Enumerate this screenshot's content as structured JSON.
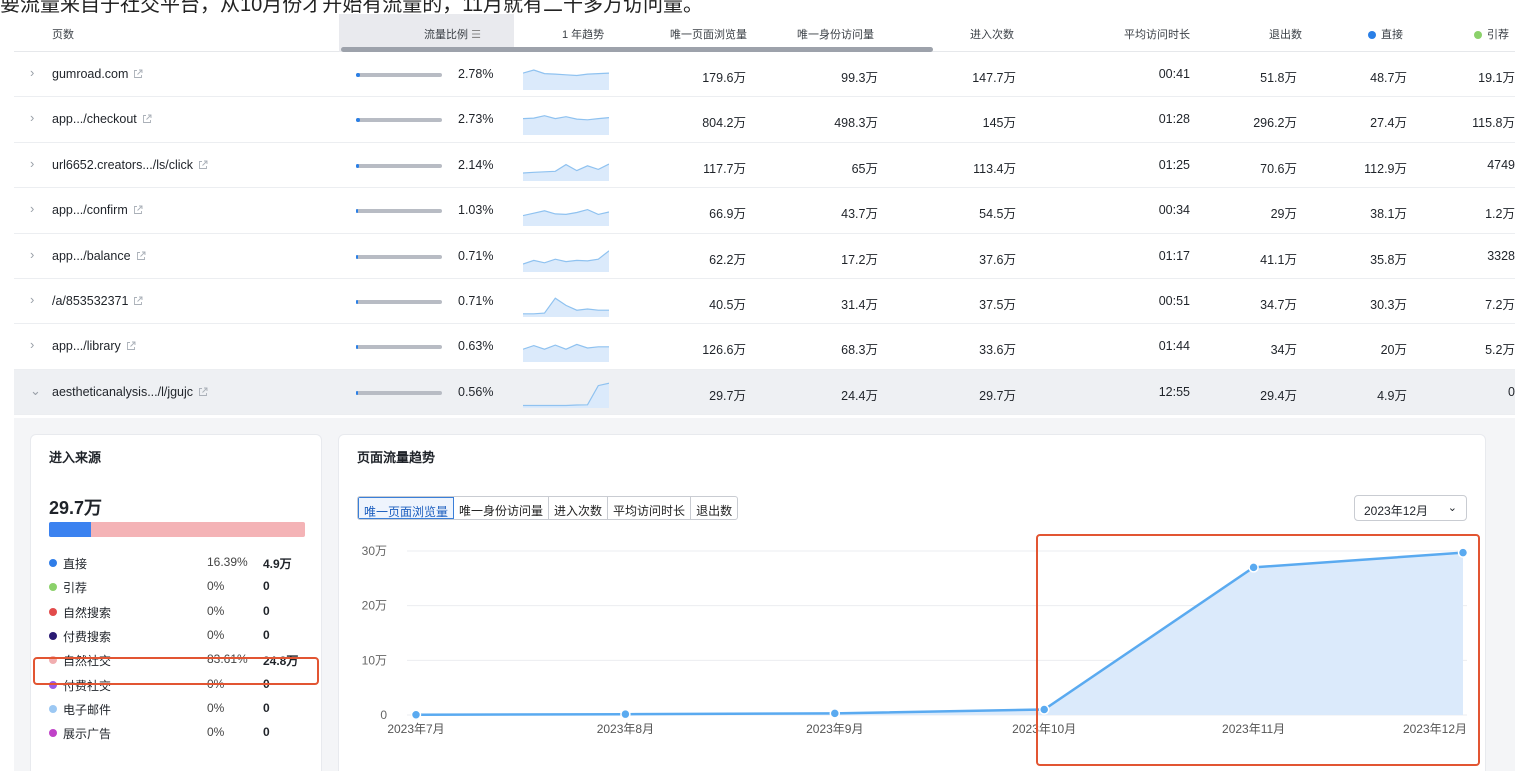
{
  "caption": "要流量来自于社交平台，从10月份才开始有流量的，11月就有二十多万访问量。",
  "table": {
    "columns": {
      "page": "页数",
      "traffic_share": "流量比例",
      "trend": "1 年趋势",
      "unique_pageviews": "唯一页面浏览量",
      "unique_visitors": "唯一身份访问量",
      "entrances": "进入次数",
      "avg_duration": "平均访问时长",
      "exits": "退出数",
      "direct": "直接",
      "referral": "引荐"
    },
    "legend_colors": {
      "direct": "#2a7fe6",
      "referral": "#8bd16a"
    },
    "rows": [
      {
        "page": "gumroad.com",
        "share_text": "2.78%",
        "share": 0.0278,
        "unique_pageviews": "179.6万",
        "unique_visitors": "99.3万",
        "entrances": "147.7万",
        "avg_duration": "00:41",
        "exits": "51.8万",
        "direct": "48.7万",
        "referral": "19.1万",
        "trend": [
          0.62,
          0.75,
          0.6,
          0.58,
          0.55,
          0.52,
          0.58,
          0.6,
          0.62
        ]
      },
      {
        "page": "app.../checkout",
        "share_text": "2.73%",
        "share": 0.0273,
        "unique_pageviews": "804.2万",
        "unique_visitors": "498.3万",
        "entrances": "145万",
        "avg_duration": "01:28",
        "exits": "296.2万",
        "direct": "27.4万",
        "referral": "115.8万",
        "trend": [
          0.6,
          0.62,
          0.72,
          0.6,
          0.68,
          0.58,
          0.55,
          0.6,
          0.64
        ]
      },
      {
        "page": "url6652.creators.../ls/click",
        "share_text": "2.14%",
        "share": 0.0214,
        "unique_pageviews": "117.7万",
        "unique_visitors": "65万",
        "entrances": "113.4万",
        "avg_duration": "01:25",
        "exits": "70.6万",
        "direct": "112.9万",
        "referral": "4749",
        "trend": [
          0.25,
          0.28,
          0.3,
          0.32,
          0.6,
          0.35,
          0.55,
          0.4,
          0.62
        ]
      },
      {
        "page": "app.../confirm",
        "share_text": "1.03%",
        "share": 0.0103,
        "unique_pageviews": "66.9万",
        "unique_visitors": "43.7万",
        "entrances": "54.5万",
        "avg_duration": "00:34",
        "exits": "29万",
        "direct": "38.1万",
        "referral": "1.2万",
        "trend": [
          0.35,
          0.45,
          0.55,
          0.42,
          0.4,
          0.48,
          0.6,
          0.4,
          0.5
        ]
      },
      {
        "page": "app.../balance",
        "share_text": "0.71%",
        "share": 0.0071,
        "unique_pageviews": "62.2万",
        "unique_visitors": "17.2万",
        "entrances": "37.6万",
        "avg_duration": "01:17",
        "exits": "41.1万",
        "direct": "35.8万",
        "referral": "3328",
        "trend": [
          0.25,
          0.4,
          0.3,
          0.45,
          0.35,
          0.4,
          0.38,
          0.45,
          0.8
        ]
      },
      {
        "page": "/a/853532371",
        "share_text": "0.71%",
        "share": 0.0071,
        "unique_pageviews": "40.5万",
        "unique_visitors": "31.4万",
        "entrances": "37.5万",
        "avg_duration": "00:51",
        "exits": "34.7万",
        "direct": "30.3万",
        "referral": "7.2万",
        "trend": [
          0.05,
          0.05,
          0.08,
          0.7,
          0.4,
          0.2,
          0.25,
          0.2,
          0.2
        ]
      },
      {
        "page": "app.../library",
        "share_text": "0.63%",
        "share": 0.0063,
        "unique_pageviews": "126.6万",
        "unique_visitors": "68.3万",
        "entrances": "33.6万",
        "avg_duration": "01:44",
        "exits": "34万",
        "direct": "20万",
        "referral": "5.2万",
        "trend": [
          0.45,
          0.6,
          0.45,
          0.62,
          0.45,
          0.65,
          0.5,
          0.55,
          0.55
        ]
      },
      {
        "page": "aestheticanalysis.../l/jgujc",
        "share_text": "0.56%",
        "share": 0.0056,
        "unique_pageviews": "29.7万",
        "unique_visitors": "24.4万",
        "entrances": "29.7万",
        "avg_duration": "12:55",
        "exits": "29.4万",
        "direct": "4.9万",
        "referral": "0",
        "trend": [
          0.02,
          0.02,
          0.02,
          0.02,
          0.02,
          0.04,
          0.05,
          0.85,
          0.95
        ]
      }
    ]
  },
  "sources": {
    "title": "进入来源",
    "total": "29.7万",
    "bar_share": [
      {
        "key": "direct",
        "share": 0.1639,
        "color": "#3b82f0"
      },
      {
        "key": "organic_social",
        "share": 0.8361,
        "color": "#f4b3b6"
      }
    ],
    "items": [
      {
        "label": "直接",
        "pct": "16.39%",
        "value": "4.9万",
        "color": "#2f7de8"
      },
      {
        "label": "引荐",
        "pct": "0%",
        "value": "0",
        "color": "#8bd16a"
      },
      {
        "label": "自然搜索",
        "pct": "0%",
        "value": "0",
        "color": "#e24b4b"
      },
      {
        "label": "付费搜索",
        "pct": "0%",
        "value": "0",
        "color": "#2a1a73"
      },
      {
        "label": "自然社交",
        "pct": "83.61%",
        "value": "24.8万",
        "color": "#f1aeb0"
      },
      {
        "label": "付费社交",
        "pct": "0%",
        "value": "0",
        "color": "#9b59e6"
      },
      {
        "label": "电子邮件",
        "pct": "0%",
        "value": "0",
        "color": "#9cc8f3"
      },
      {
        "label": "展示广告",
        "pct": "0%",
        "value": "0",
        "color": "#c042c8"
      }
    ]
  },
  "trend_panel": {
    "title": "页面流量趋势",
    "tabs": [
      "唯一页面浏览量",
      "唯一身份访问量",
      "进入次数",
      "平均访问时长",
      "退出数"
    ],
    "active_tab": 0,
    "month_select": "2023年12月"
  },
  "chart_data": {
    "type": "area",
    "x": [
      "2023年7月",
      "2023年8月",
      "2023年9月",
      "2023年10月",
      "2023年11月",
      "2023年12月"
    ],
    "series": [
      {
        "values": [
          500,
          1500,
          3000,
          10000,
          270000,
          297000
        ]
      }
    ],
    "yticks": [
      "0",
      "10万",
      "20万",
      "30万"
    ],
    "ylim": [
      0,
      300000
    ],
    "line_color": "#5aaaf0",
    "fill_color": "#dbeafb",
    "grid": true
  }
}
